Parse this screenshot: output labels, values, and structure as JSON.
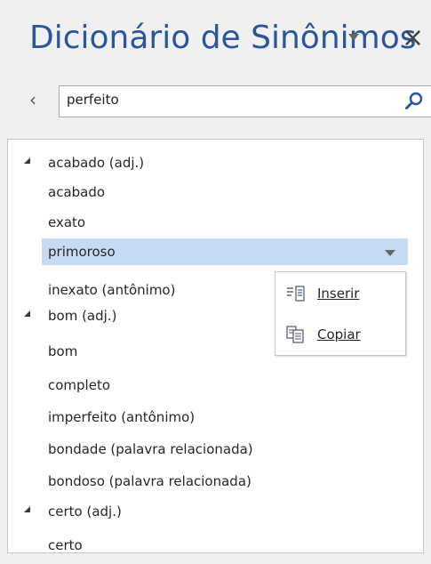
{
  "pane": {
    "title": "Dicionário de Sinônimos",
    "options_icon": "chevron-down-icon",
    "close_icon": "close-icon",
    "close_glyph": "×"
  },
  "search": {
    "back_glyph": "‹",
    "value": "perfeito",
    "icon": "search-icon"
  },
  "results": {
    "groups": [
      {
        "header": "acabado (adj.)",
        "items": [
          "acabado",
          "exato",
          "primoroso",
          "inexato (antônimo)"
        ]
      },
      {
        "header": "bom (adj.)",
        "items": [
          "bom",
          "completo",
          "imperfeito (antônimo)",
          "bondade (palavra relacionada)",
          "bondoso (palavra relacionada)"
        ]
      },
      {
        "header": "certo (adj.)",
        "items": [
          "certo"
        ]
      }
    ],
    "selected_item": "primoroso"
  },
  "context_menu": {
    "insert_label": "Inserir",
    "copy_label": "Copiar",
    "insert_icon": "insert-icon",
    "copy_icon": "copy-icon"
  },
  "colors": {
    "title": "#2b579a",
    "selection": "#c6dbf3",
    "pane_bg": "#f0f0f0"
  }
}
